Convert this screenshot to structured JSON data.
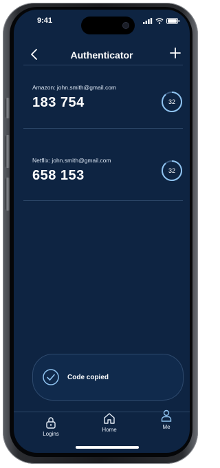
{
  "status_bar": {
    "time": "9:41"
  },
  "header": {
    "title": "Authenticator",
    "back_icon": "chevron-left-icon",
    "add_icon": "plus-icon"
  },
  "accounts": [
    {
      "label": "Amazon: john.smith@gmail.com",
      "code": "183 754",
      "seconds": "32"
    },
    {
      "label": "Netflix: john.smith@gmail.com",
      "code": "658 153",
      "seconds": "32"
    }
  ],
  "toast": {
    "message": "Code copied",
    "icon": "check-circle-icon"
  },
  "tabbar": {
    "items": [
      {
        "label": "Logins",
        "icon": "lock-icon"
      },
      {
        "label": "Home",
        "icon": "home-icon"
      },
      {
        "label": "Me",
        "icon": "user-icon",
        "active": true
      }
    ]
  },
  "colors": {
    "background": "#0e2442",
    "accent": "#8fc3f0",
    "text": "#ffffff",
    "divider": "#2c4668"
  }
}
